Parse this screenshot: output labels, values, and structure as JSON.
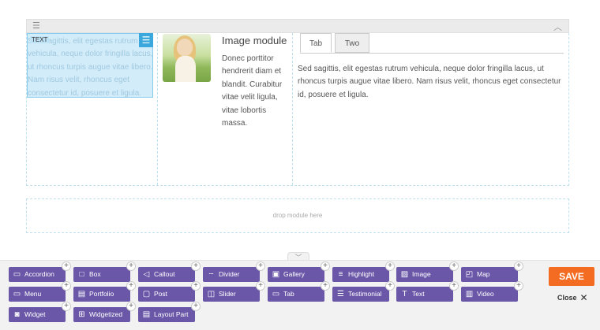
{
  "builder": {
    "text_module": {
      "tag": "TEXT",
      "text": "Sed sagittis, elit egestas rutrum vehicula, neque dolor fringilla lacus, ut rhoncus turpis augue vitae libero. Nam risus velit, rhoncus eget consectetur id, posuere et ligula."
    },
    "image_module": {
      "title": "Image module",
      "text": "Donec porttitor hendrerit diam et blandit. Curabitur vitae velit ligula, vitae lobortis massa."
    },
    "tabs_module": {
      "tabs": [
        "Tab",
        "Two"
      ],
      "text": "Sed sagittis, elit egestas rutrum vehicula, neque dolor fringilla lacus, ut rhoncus turpis augue vitae libero. Nam risus velit, rhoncus eget consectetur id, posuere et ligula."
    },
    "drop_zone": "drop module here"
  },
  "modules": [
    {
      "label": "Accordion",
      "icon": "accordion-icon",
      "glyph": "▭"
    },
    {
      "label": "Box",
      "icon": "box-icon",
      "glyph": "□"
    },
    {
      "label": "Callout",
      "icon": "megaphone-icon",
      "glyph": "◁"
    },
    {
      "label": "Divider",
      "icon": "divider-icon",
      "glyph": "┄"
    },
    {
      "label": "Gallery",
      "icon": "gallery-icon",
      "glyph": "▣"
    },
    {
      "label": "Highlight",
      "icon": "highlight-icon",
      "glyph": "≡"
    },
    {
      "label": "Image",
      "icon": "image-icon",
      "glyph": "▨"
    },
    {
      "label": "Map",
      "icon": "map-icon",
      "glyph": "◰"
    },
    {
      "label": "Menu",
      "icon": "menu-icon",
      "glyph": "▭"
    },
    {
      "label": "Portfolio",
      "icon": "briefcase-icon",
      "glyph": "▤"
    },
    {
      "label": "Post",
      "icon": "post-icon",
      "glyph": "▢"
    },
    {
      "label": "Slider",
      "icon": "slider-icon",
      "glyph": "◫"
    },
    {
      "label": "Tab",
      "icon": "folder-icon",
      "glyph": "▭"
    },
    {
      "label": "Testimonial",
      "icon": "testimonial-icon",
      "glyph": "☰"
    },
    {
      "label": "Text",
      "icon": "text-icon",
      "glyph": "T"
    },
    {
      "label": "Video",
      "icon": "video-icon",
      "glyph": "▥"
    },
    {
      "label": "Widget",
      "icon": "widget-icon",
      "glyph": "◙"
    },
    {
      "label": "Widgetized",
      "icon": "widgetized-icon",
      "glyph": "⊞"
    },
    {
      "label": "Layout Part",
      "icon": "layout-part-icon",
      "glyph": "▤"
    }
  ],
  "actions": {
    "save": "SAVE",
    "close": "Close"
  },
  "colors": {
    "module_button": "#6a57a8",
    "save_button": "#f36c21",
    "selection": "#d3ecf9"
  }
}
